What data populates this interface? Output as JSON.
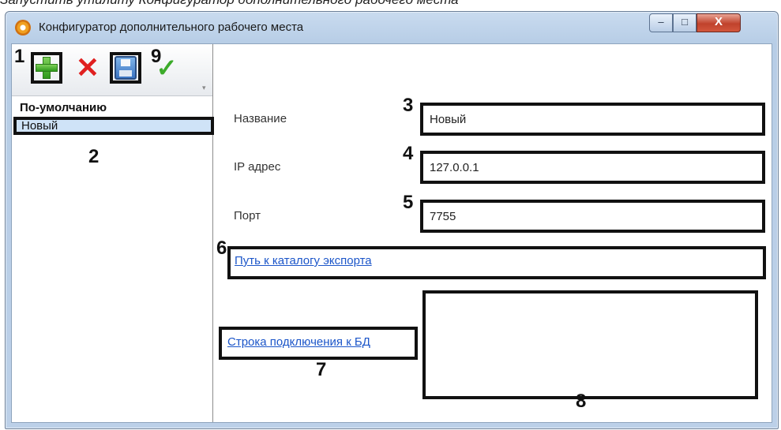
{
  "caption": "Запустить утилиту Конфигуратор дополнительного рабочего места",
  "window": {
    "title": "Конфигуратор дополнительного рабочего места",
    "controls": {
      "minimize": "–",
      "maximize": "□",
      "close": "X"
    }
  },
  "toolbar": {
    "add_icon": "plus-icon",
    "delete_icon": "x-icon",
    "save_icon": "floppy-icon",
    "apply_icon": "checkmark-icon"
  },
  "list": {
    "header": "По-умолчанию",
    "items": [
      "Новый"
    ]
  },
  "form": {
    "name_label": "Название",
    "name_value": "Новый",
    "ip_label": "IP адрес",
    "ip_value": "127.0.0.1",
    "port_label": "Порт",
    "port_value": "7755",
    "export_path_link": "Путь к каталогу экспорта",
    "export_path_value": "",
    "db_string_link": "Строка подключения к БД",
    "db_string_value": ""
  },
  "callouts": [
    "1",
    "2",
    "3",
    "4",
    "5",
    "6",
    "7",
    "8",
    "9"
  ],
  "colors": {
    "link": "#1c56c9",
    "close_button": "#c0422c",
    "selection": "#cfe3f7"
  }
}
